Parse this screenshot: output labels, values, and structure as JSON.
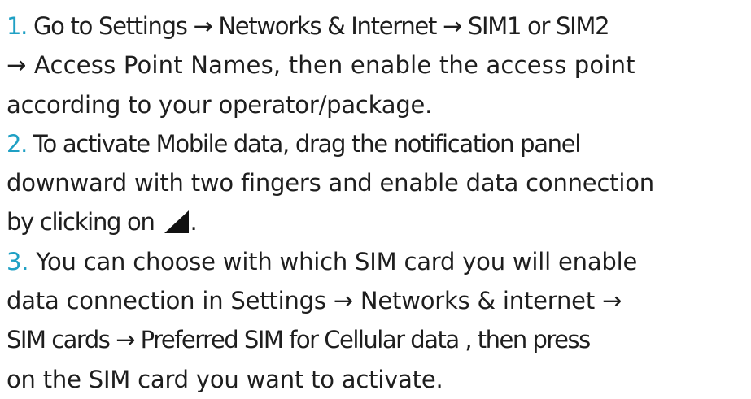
{
  "steps": [
    {
      "number": "1.",
      "lines": [
        [
          "Go to Settings ",
          "→",
          " Networks & Internet ",
          "→",
          " SIM1 or SIM2"
        ],
        [
          "→",
          " Access Point Names, then enable the access point"
        ],
        [
          "according to your operator/package."
        ]
      ]
    },
    {
      "number": "2.",
      "lines": [
        [
          "To activate Mobile data, drag the notification panel"
        ],
        [
          "downward with two fingers and enable data connection"
        ],
        [
          "by clicking on ",
          "."
        ]
      ]
    },
    {
      "number": "3.",
      "lines": [
        [
          "You can choose with which SIM card you will enable"
        ],
        [
          "data connection in Settings ",
          "→",
          " Networks & internet ",
          "→"
        ],
        [
          "SIM cards ",
          "→",
          " Preferred SIM for Cellular data , then press"
        ],
        [
          "on the SIM card you want to activate."
        ]
      ]
    }
  ],
  "colors": {
    "step_number": "#1fa0c4",
    "text": "#1e1e1e"
  },
  "icons": {
    "signal": "mobile-signal-icon"
  }
}
